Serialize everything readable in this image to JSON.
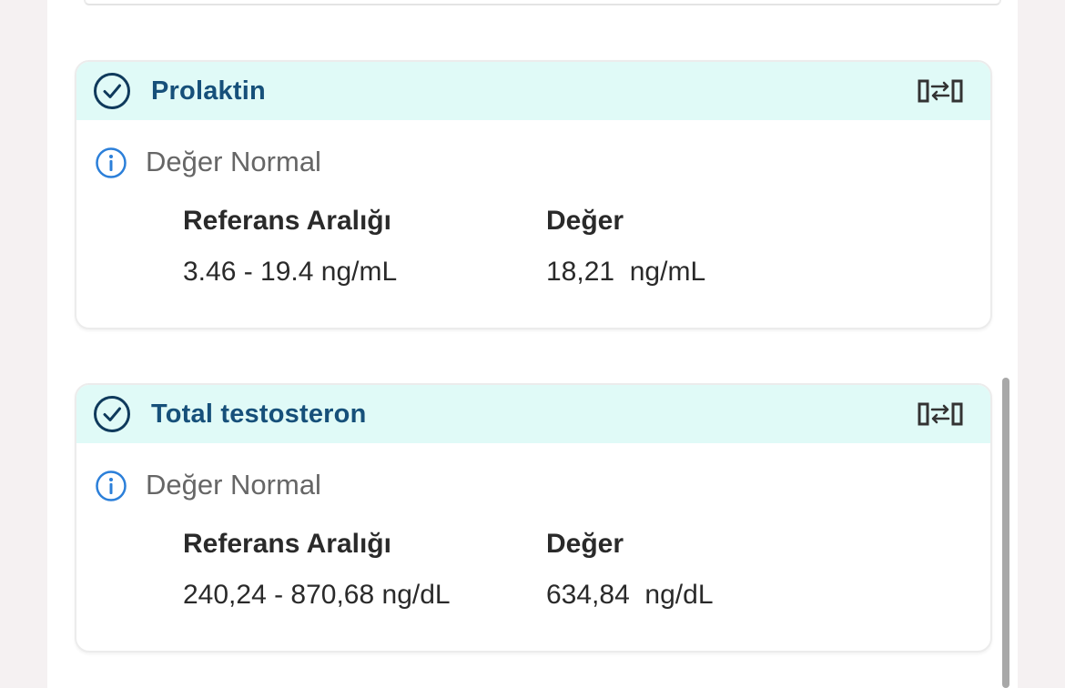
{
  "cards": [
    {
      "title": "Prolaktin",
      "status": "Değer Normal",
      "reference_label": "Referans Aralığı",
      "reference_value": "3.46 - 19.4 ng/mL",
      "value_label": "Değer",
      "value": "18,21  ng/mL"
    },
    {
      "title": "Total testosteron",
      "status": "Değer Normal",
      "reference_label": "Referans Aralığı",
      "reference_value": "240,24 - 870,68 ng/dL",
      "value_label": "Değer",
      "value": "634,84  ng/dL"
    }
  ],
  "icons": {
    "header_status": "check-circle-icon",
    "compare": "compare-arrows-icon",
    "info": "info-circle-icon"
  },
  "colors": {
    "header_bg": "#e0faf7",
    "title": "#16507a",
    "check": "#0f3a5c",
    "info": "#2b7fd9"
  }
}
